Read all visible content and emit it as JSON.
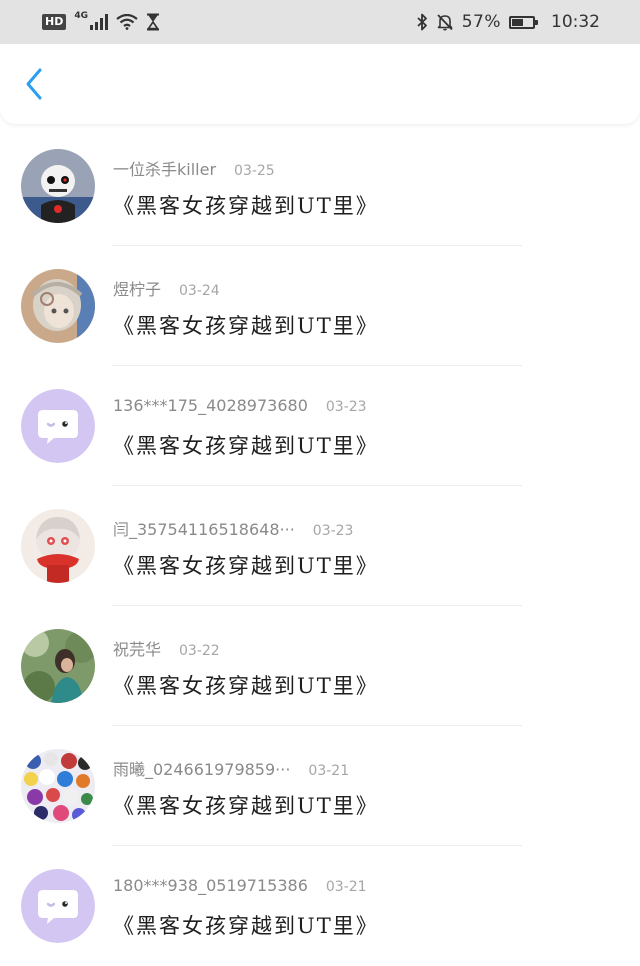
{
  "status_bar": {
    "hd_label": "HD",
    "network_label": "4G",
    "battery_percent": "57%",
    "battery_level": 0.57,
    "time": "10:32"
  },
  "header": {
    "back_icon": "chevron-left-icon",
    "accent_color": "#2b9ef0"
  },
  "comments": [
    {
      "username": "一位杀手killer",
      "date": "03-25",
      "message": "《黑客女孩穿越到UT里》",
      "avatar": "sans-skeleton-avatar"
    },
    {
      "username": "煜柠子",
      "date": "03-24",
      "message": "《黑客女孩穿越到UT里》",
      "avatar": "anime-girl-avatar"
    },
    {
      "username": "136***175_4028973680",
      "date": "03-23",
      "message": "《黑客女孩穿越到UT里》",
      "avatar": "default-chat-avatar"
    },
    {
      "username": "闫_35754116518648···",
      "date": "03-23",
      "message": "《黑客女孩穿越到UT里》",
      "avatar": "red-scarf-character-avatar"
    },
    {
      "username": "祝芫华",
      "date": "03-22",
      "message": "《黑客女孩穿越到UT里》",
      "avatar": "forest-girl-avatar"
    },
    {
      "username": "雨曦_024661979859···",
      "date": "03-21",
      "message": "《黑客女孩穿越到UT里》",
      "avatar": "character-collage-avatar"
    },
    {
      "username": "180***938_0519715386",
      "date": "03-21",
      "message": "《黑客女孩穿越到UT里》",
      "avatar": "default-chat-avatar"
    }
  ]
}
